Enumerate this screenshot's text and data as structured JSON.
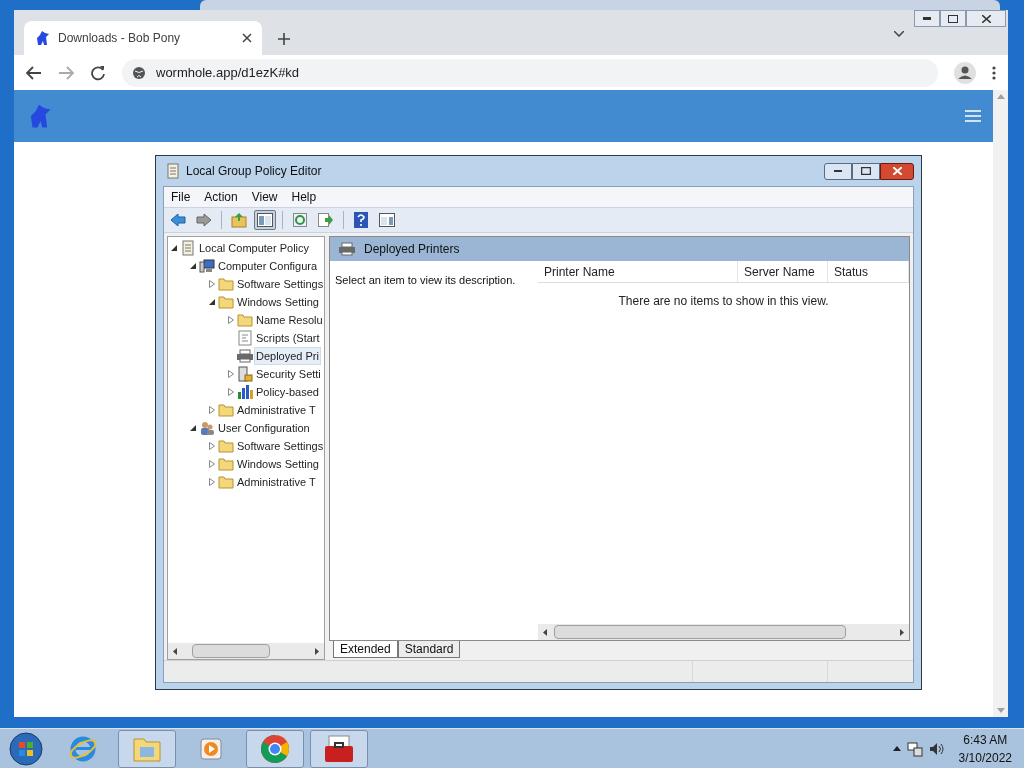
{
  "browser": {
    "tabs": [
      {
        "title": "Downloads - Bob Pony",
        "selected": true
      }
    ],
    "address": "wormhole.app/d1ezK#kd"
  },
  "app": {
    "title": "Local Group Policy Editor",
    "menu": [
      "File",
      "Action",
      "View",
      "Help"
    ],
    "toolbar": [
      {
        "kind": "back",
        "pressed": false
      },
      {
        "kind": "forward",
        "pressed": false
      },
      {
        "kind": "sep"
      },
      {
        "kind": "up",
        "pressed": false
      },
      {
        "kind": "tree",
        "pressed": true
      },
      {
        "kind": "sep"
      },
      {
        "kind": "refresh",
        "pressed": false
      },
      {
        "kind": "export",
        "pressed": false
      },
      {
        "kind": "sep"
      },
      {
        "kind": "help",
        "pressed": false
      },
      {
        "kind": "view",
        "pressed": false
      }
    ],
    "tree": [
      {
        "label": "Local Computer Policy",
        "kind": "policy",
        "selected": false,
        "expanded": true,
        "children": [
          {
            "label": "Computer Configura",
            "kind": "computer",
            "selected": false,
            "expanded": true,
            "children": [
              {
                "label": "Software Settings",
                "kind": "folder",
                "selected": false,
                "expanded": false
              },
              {
                "label": "Windows Setting",
                "kind": "folder",
                "selected": false,
                "expanded": true,
                "children": [
                  {
                    "label": "Name Resolu",
                    "kind": "folder",
                    "selected": false,
                    "expanded": false
                  },
                  {
                    "label": "Scripts (Start",
                    "kind": "script",
                    "selected": false
                  },
                  {
                    "label": "Deployed Pri",
                    "kind": "printer",
                    "selected": true
                  },
                  {
                    "label": "Security Setti",
                    "kind": "security",
                    "selected": false,
                    "expanded": false
                  },
                  {
                    "label": "Policy-based",
                    "kind": "chart",
                    "selected": false,
                    "expanded": false
                  }
                ]
              },
              {
                "label": "Administrative T",
                "kind": "folder",
                "selected": false,
                "expanded": false
              }
            ]
          },
          {
            "label": "User Configuration",
            "kind": "user",
            "selected": false,
            "expanded": true,
            "children": [
              {
                "label": "Software Settings",
                "kind": "folder",
                "selected": false,
                "expanded": false
              },
              {
                "label": "Windows Setting",
                "kind": "folder",
                "selected": false,
                "expanded": false
              },
              {
                "label": "Administrative T",
                "kind": "folder",
                "selected": false,
                "expanded": false
              }
            ]
          }
        ]
      }
    ],
    "pane_title": "Deployed Printers",
    "description": "Select an item to view its description.",
    "columns": [
      "Printer Name",
      "Server Name",
      "Status"
    ],
    "empty_message": "There are no items to show in this view.",
    "view_tabs": [
      {
        "label": "Extended",
        "selected": true
      },
      {
        "label": "Standard",
        "selected": false
      }
    ]
  },
  "taskbar": {
    "items": [
      {
        "kind": "ie",
        "active": false
      },
      {
        "kind": "explorer",
        "active": true
      },
      {
        "kind": "media",
        "active": false
      },
      {
        "kind": "chrome",
        "active": true
      },
      {
        "kind": "toolbox",
        "active": true
      }
    ],
    "time": "6:43 AM",
    "date": "3/10/2022"
  }
}
